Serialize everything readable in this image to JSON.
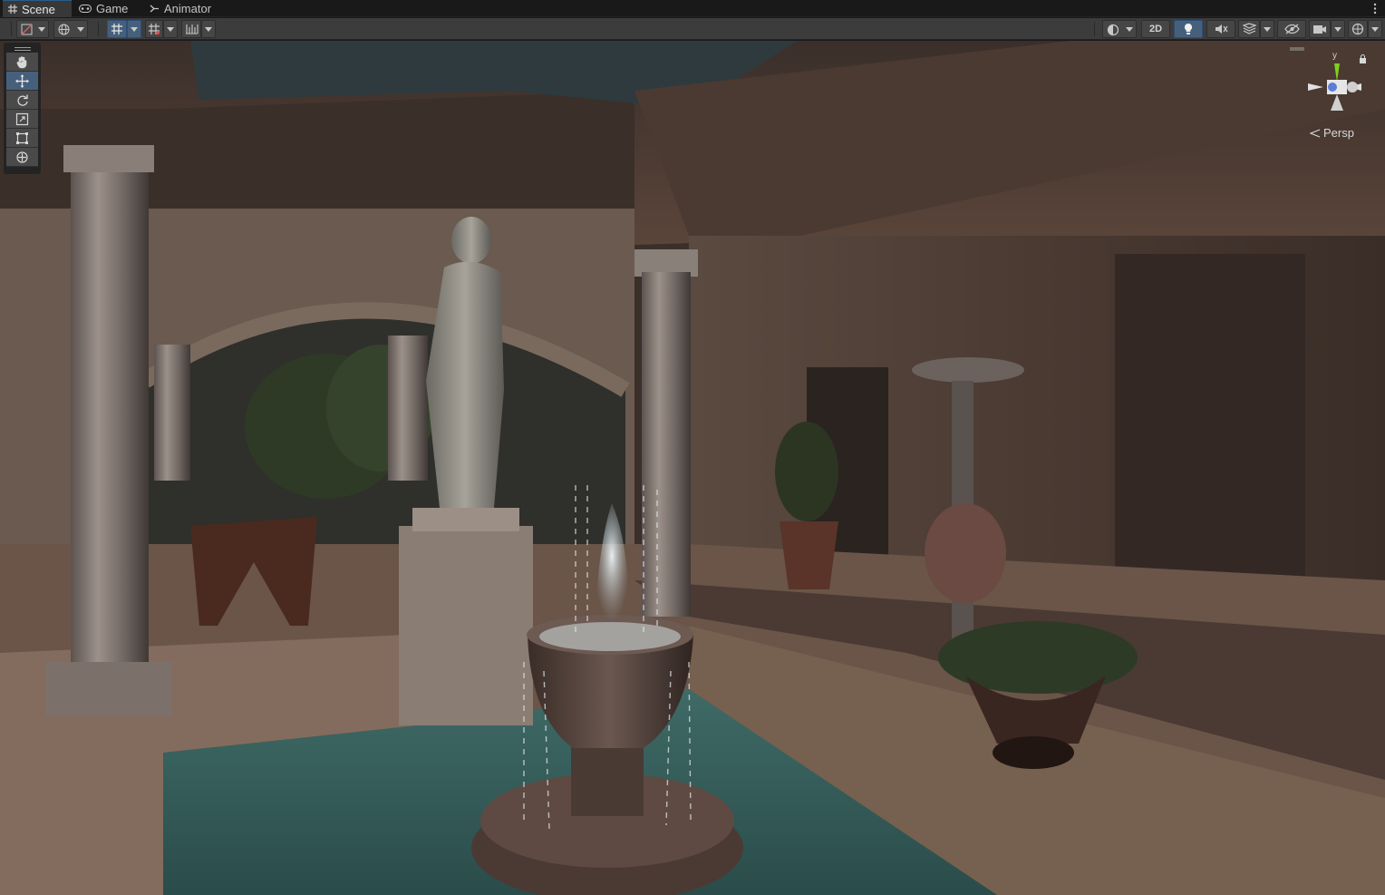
{
  "tabs": {
    "scene": "Scene",
    "game": "Game",
    "animator": "Animator"
  },
  "toolbar": {
    "mode_2d": "2D"
  },
  "viewport": {
    "projection": "Persp",
    "gizmo_axis_y": "y"
  },
  "colors": {
    "selected": "#46607c",
    "toolbar_bg": "#3c3c3c",
    "tab_bg": "#191919",
    "gizmo_y": "#7ed021",
    "gizmo_x": "#e0e0e0"
  },
  "icons": [
    "scene-grid-icon",
    "gamepad-icon",
    "animator-icon",
    "kebab-menu-icon",
    "shading-mode-icon",
    "globe-icon",
    "grid-snap-icon",
    "increment-snap-icon",
    "ruler-icon",
    "render-mode-icon",
    "lighting-icon",
    "audio-icon",
    "effects-icon",
    "visibility-icon",
    "camera-icon",
    "gizmos-icon",
    "hand-tool-icon",
    "move-tool-icon",
    "rotate-tool-icon",
    "scale-tool-icon",
    "rect-tool-icon",
    "transform-tool-icon",
    "lock-icon",
    "orientation-gizmo-icon"
  ]
}
